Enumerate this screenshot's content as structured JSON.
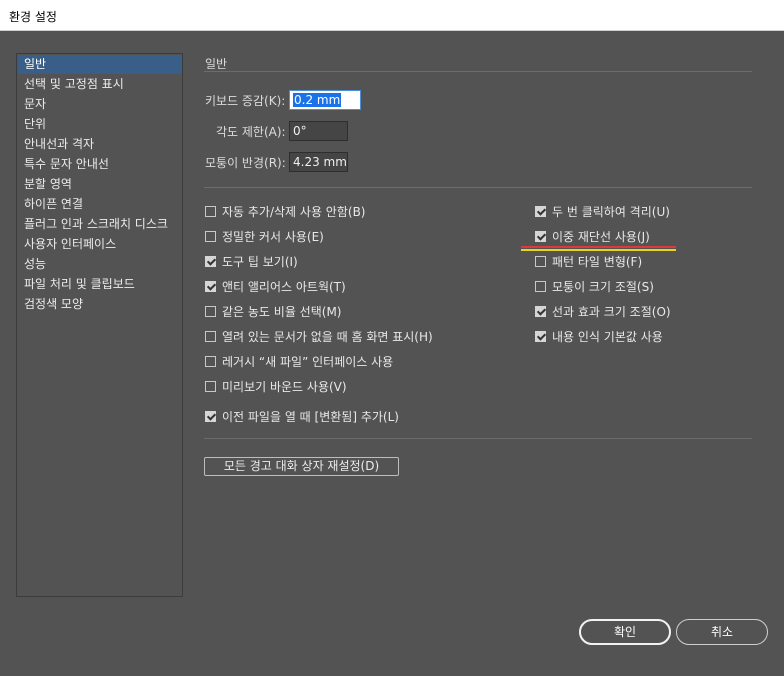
{
  "window": {
    "title": "환경 설정"
  },
  "sidebar": {
    "items": [
      "일반",
      "선택 및 고정점 표시",
      "문자",
      "단위",
      "안내선과 격자",
      "특수 문자 안내선",
      "분할 영역",
      "하이픈 연결",
      "플러그 인과 스크래치 디스크",
      "사용자 인터페이스",
      "성능",
      "파일 처리 및 클립보드",
      "검정색 모양"
    ],
    "selected_index": 0
  },
  "general": {
    "section_title": "일반",
    "keyboard_increment": {
      "label": "키보드 증감(K):",
      "value": "0.2 mm"
    },
    "constrain_angle": {
      "label": "각도 제한(A):",
      "value": "0°"
    },
    "corner_radius": {
      "label": "모퉁이 반경(R):",
      "value": "4.23 mm"
    },
    "left_options": [
      {
        "label": "자동 추가/삭제 사용 안함(B)",
        "checked": false
      },
      {
        "label": "정밀한 커서 사용(E)",
        "checked": false
      },
      {
        "label": "도구 팁 보기(I)",
        "checked": true
      },
      {
        "label": "앤티 앨리어스 아트웍(T)",
        "checked": true
      },
      {
        "label": "같은 농도 비율 선택(M)",
        "checked": false
      },
      {
        "label": "열려 있는 문서가 없을 때 홈 화면 표시(H)",
        "checked": false
      },
      {
        "label": "레거시 “새 파일” 인터페이스 사용",
        "checked": false
      },
      {
        "label": "미리보기 바운드 사용(V)",
        "checked": false
      },
      {
        "label": "이전 파일을 열 때 [변환됨] 추가(L)",
        "checked": true
      }
    ],
    "right_options": [
      {
        "label": "두 번 클릭하여 격리(U)",
        "checked": true
      },
      {
        "label": "이중 재단선 사용(J)",
        "checked": true
      },
      {
        "label": "패턴 타일 변형(F)",
        "checked": false
      },
      {
        "label": "모퉁이 크기 조절(S)",
        "checked": false
      },
      {
        "label": "선과 효과 크기 조절(O)",
        "checked": true
      },
      {
        "label": "내용 인식 기본값 사용",
        "checked": true
      }
    ],
    "reset_warnings_label": "모든 경고 대화 상자 재설정(D)"
  },
  "footer": {
    "ok_label": "확인",
    "cancel_label": "취소"
  },
  "colors": {
    "background": "#535353",
    "selection": "#395e87",
    "highlight_red": "#e03838",
    "highlight_yellow": "#e8d21a"
  }
}
